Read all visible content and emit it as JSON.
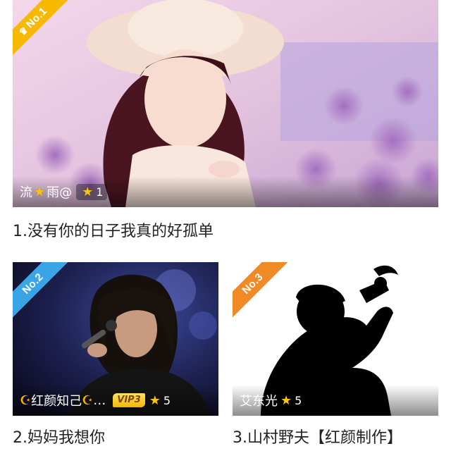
{
  "items": [
    {
      "rank": "No.1",
      "ribbon_color": "#f7b800",
      "user": {
        "name_part1": "流",
        "name_part2": "雨@",
        "level": "1"
      },
      "title": "1.没有你的日子我真的好孤单"
    },
    {
      "rank": "No.2",
      "ribbon_color": "#3aa5e6",
      "user": {
        "name": "红颜知己",
        "ellipsis": "…",
        "vip": "VIP3",
        "level": "5"
      },
      "title": "2.妈妈我想你"
    },
    {
      "rank": "No.3",
      "ribbon_color": "#f08a24",
      "user": {
        "name": "艾东光",
        "level": "5"
      },
      "title": "3.山村野夫【红颜制作】"
    }
  ],
  "icons": [
    "crown-icon",
    "star-icon",
    "crescent-star-icon",
    "vip-badge"
  ]
}
